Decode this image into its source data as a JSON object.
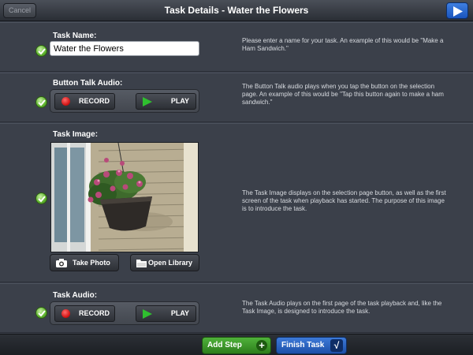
{
  "navbar": {
    "cancel_label": "Cancel",
    "title": "Task Details - Water the Flowers",
    "play_icon": "play-icon"
  },
  "task_name": {
    "title": "Task Name:",
    "value": "Water the Flowers",
    "help": "Please enter a name for your task.  An example of this would be \"Make a Ham Sandwich.\""
  },
  "button_talk_audio": {
    "title": "Button Talk Audio:",
    "record_label": "RECORD",
    "play_label": "PLAY",
    "help": "The Button Talk audio plays when you tap the button on the selection page.  An example of this would be \"Tap this button again to make a ham sandwich.\""
  },
  "task_image": {
    "title": "Task Image:",
    "take_photo_label": "Take Photo",
    "open_library_label": "Open Library",
    "help": "The Task Image displays on the selection page button, as well as the first screen of the task when playback has started. The purpose of this image is to introduce the task."
  },
  "task_audio": {
    "title": "Task Audio:",
    "record_label": "RECORD",
    "play_label": "PLAY",
    "help": "The Task Audio plays on the first page of the task playback and, like the Task Image, is designed to introduce the task."
  },
  "bottom_bar": {
    "add_step_label": "Add Step",
    "add_icon": "+",
    "finish_label": "Finish Task",
    "finish_icon": "√"
  },
  "colors": {
    "background": "#3a3f4a",
    "check_green": "#5fb42f",
    "record_red": "#d11414",
    "play_green": "#2fbf2f",
    "add_green": "#4fb23a",
    "finish_blue": "#3d7ad8",
    "nav_blue": "#1a55bd"
  }
}
